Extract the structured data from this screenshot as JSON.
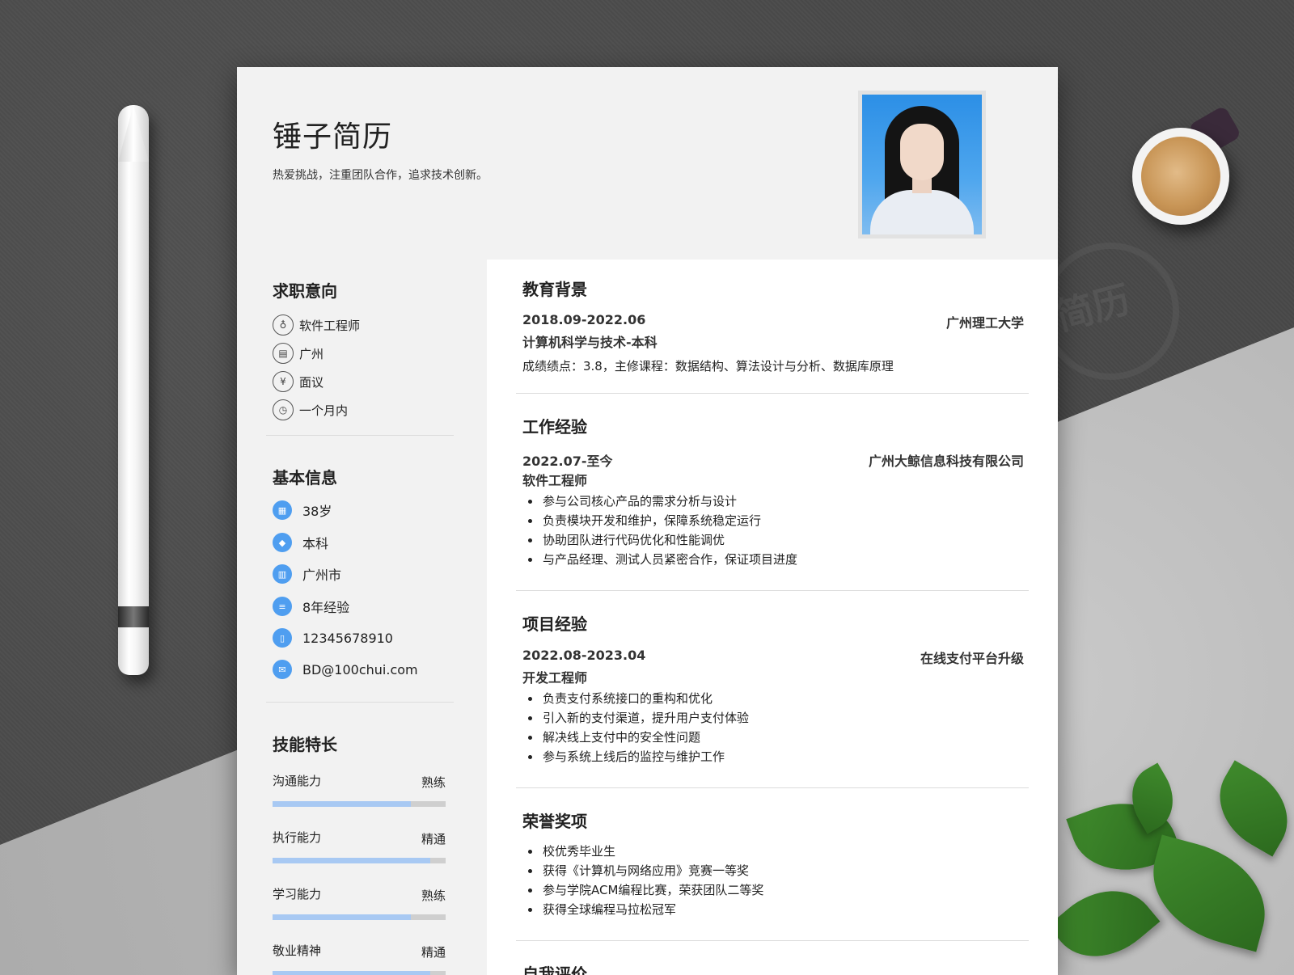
{
  "header": {
    "name": "锤子简历",
    "motto": "热爱挑战，注重团队合作，追求技术创新。"
  },
  "stamp": {
    "text": "简历"
  },
  "job_intent": {
    "title": "求职意向",
    "items": [
      {
        "icon": "tie-icon",
        "glyph": "♁",
        "text": "软件工程师"
      },
      {
        "icon": "building-icon",
        "glyph": "▤",
        "text": "广州"
      },
      {
        "icon": "yuan-icon",
        "glyph": "¥",
        "text": "面议"
      },
      {
        "icon": "clock-icon",
        "glyph": "◷",
        "text": "一个月内"
      }
    ]
  },
  "basic_info": {
    "title": "基本信息",
    "items": [
      {
        "icon": "calendar-icon",
        "glyph": "▦",
        "text": "38岁"
      },
      {
        "icon": "graduation-cap-icon",
        "glyph": "◆",
        "text": "本科"
      },
      {
        "icon": "city-icon",
        "glyph": "▥",
        "text": "广州市"
      },
      {
        "icon": "document-icon",
        "glyph": "≡",
        "text": "8年经验"
      },
      {
        "icon": "phone-icon",
        "glyph": "▯",
        "text": "12345678910"
      },
      {
        "icon": "email-icon",
        "glyph": "✉",
        "text": "BD@100chui.com"
      }
    ]
  },
  "skills": {
    "title": "技能特长",
    "items": [
      {
        "name": "沟通能力",
        "level": "熟练",
        "percent": 80
      },
      {
        "name": "执行能力",
        "level": "精通",
        "percent": 91
      },
      {
        "name": "学习能力",
        "level": "熟练",
        "percent": 80
      },
      {
        "name": "敬业精神",
        "level": "精通",
        "percent": 91
      }
    ]
  },
  "education": {
    "title": "教育背景",
    "date": "2018.09-2022.06",
    "school": "广州理工大学",
    "major": "计算机科学与技术-本科",
    "detail": "成绩绩点：3.8，主修课程：数据结构、算法设计与分析、数据库原理"
  },
  "work": {
    "title": "工作经验",
    "date": "2022.07-至今",
    "company": "广州大鲸信息科技有限公司",
    "role": "软件工程师",
    "bullets": [
      "参与公司核心产品的需求分析与设计",
      "负责模块开发和维护，保障系统稳定运行",
      "协助团队进行代码优化和性能调优",
      "与产品经理、测试人员紧密合作，保证项目进度"
    ]
  },
  "project": {
    "title": "项目经验",
    "date": "2022.08-2023.04",
    "name": "在线支付平台升级",
    "role": "开发工程师",
    "bullets": [
      "负责支付系统接口的重构和优化",
      "引入新的支付渠道，提升用户支付体验",
      "解决线上支付中的安全性问题",
      "参与系统上线后的监控与维护工作"
    ]
  },
  "honors": {
    "title": "荣誉奖项",
    "bullets": [
      "校优秀毕业生",
      "获得《计算机与网络应用》竞赛一等奖",
      "参与学院ACM编程比赛，荣获团队二等奖",
      "获得全球编程马拉松冠军"
    ]
  },
  "self_eval": {
    "title": "自我评价"
  }
}
